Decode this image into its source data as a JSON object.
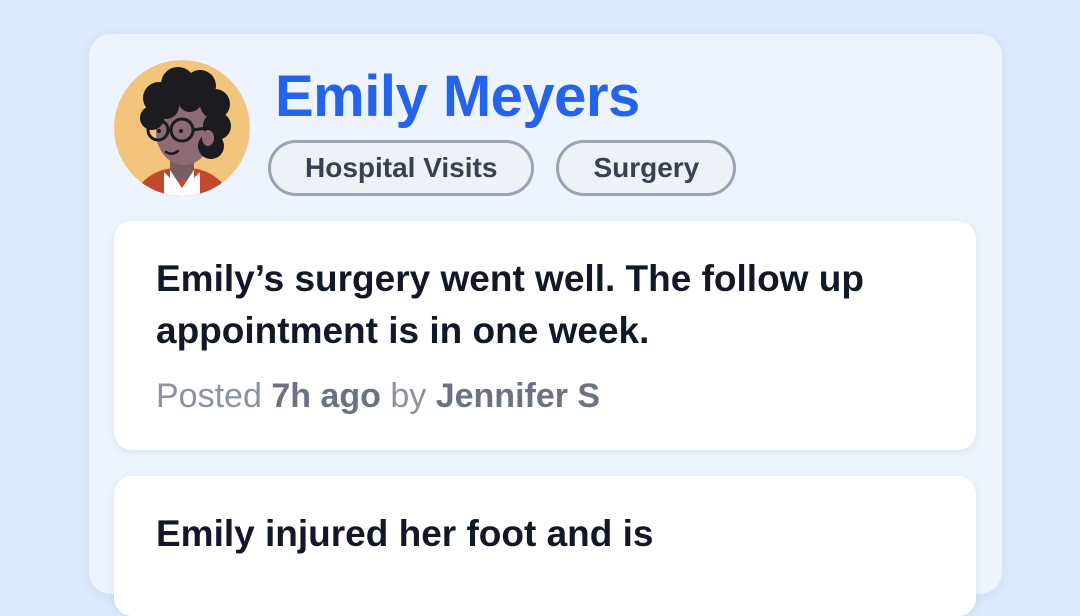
{
  "profile": {
    "name": "Emily Meyers",
    "tags": [
      "Hospital Visits",
      "Surgery"
    ]
  },
  "posts": [
    {
      "text": "Emily’s surgery went well. The follow up appointment is in one week.",
      "meta": {
        "posted_label": "Posted",
        "time": "7h ago",
        "by_label": "by",
        "author": "Jennifer S"
      }
    },
    {
      "text": "Emily injured her foot and is"
    }
  ],
  "colors": {
    "accent": "#2563eb",
    "background": "#dbeafd",
    "panel": "#edf4fe"
  }
}
